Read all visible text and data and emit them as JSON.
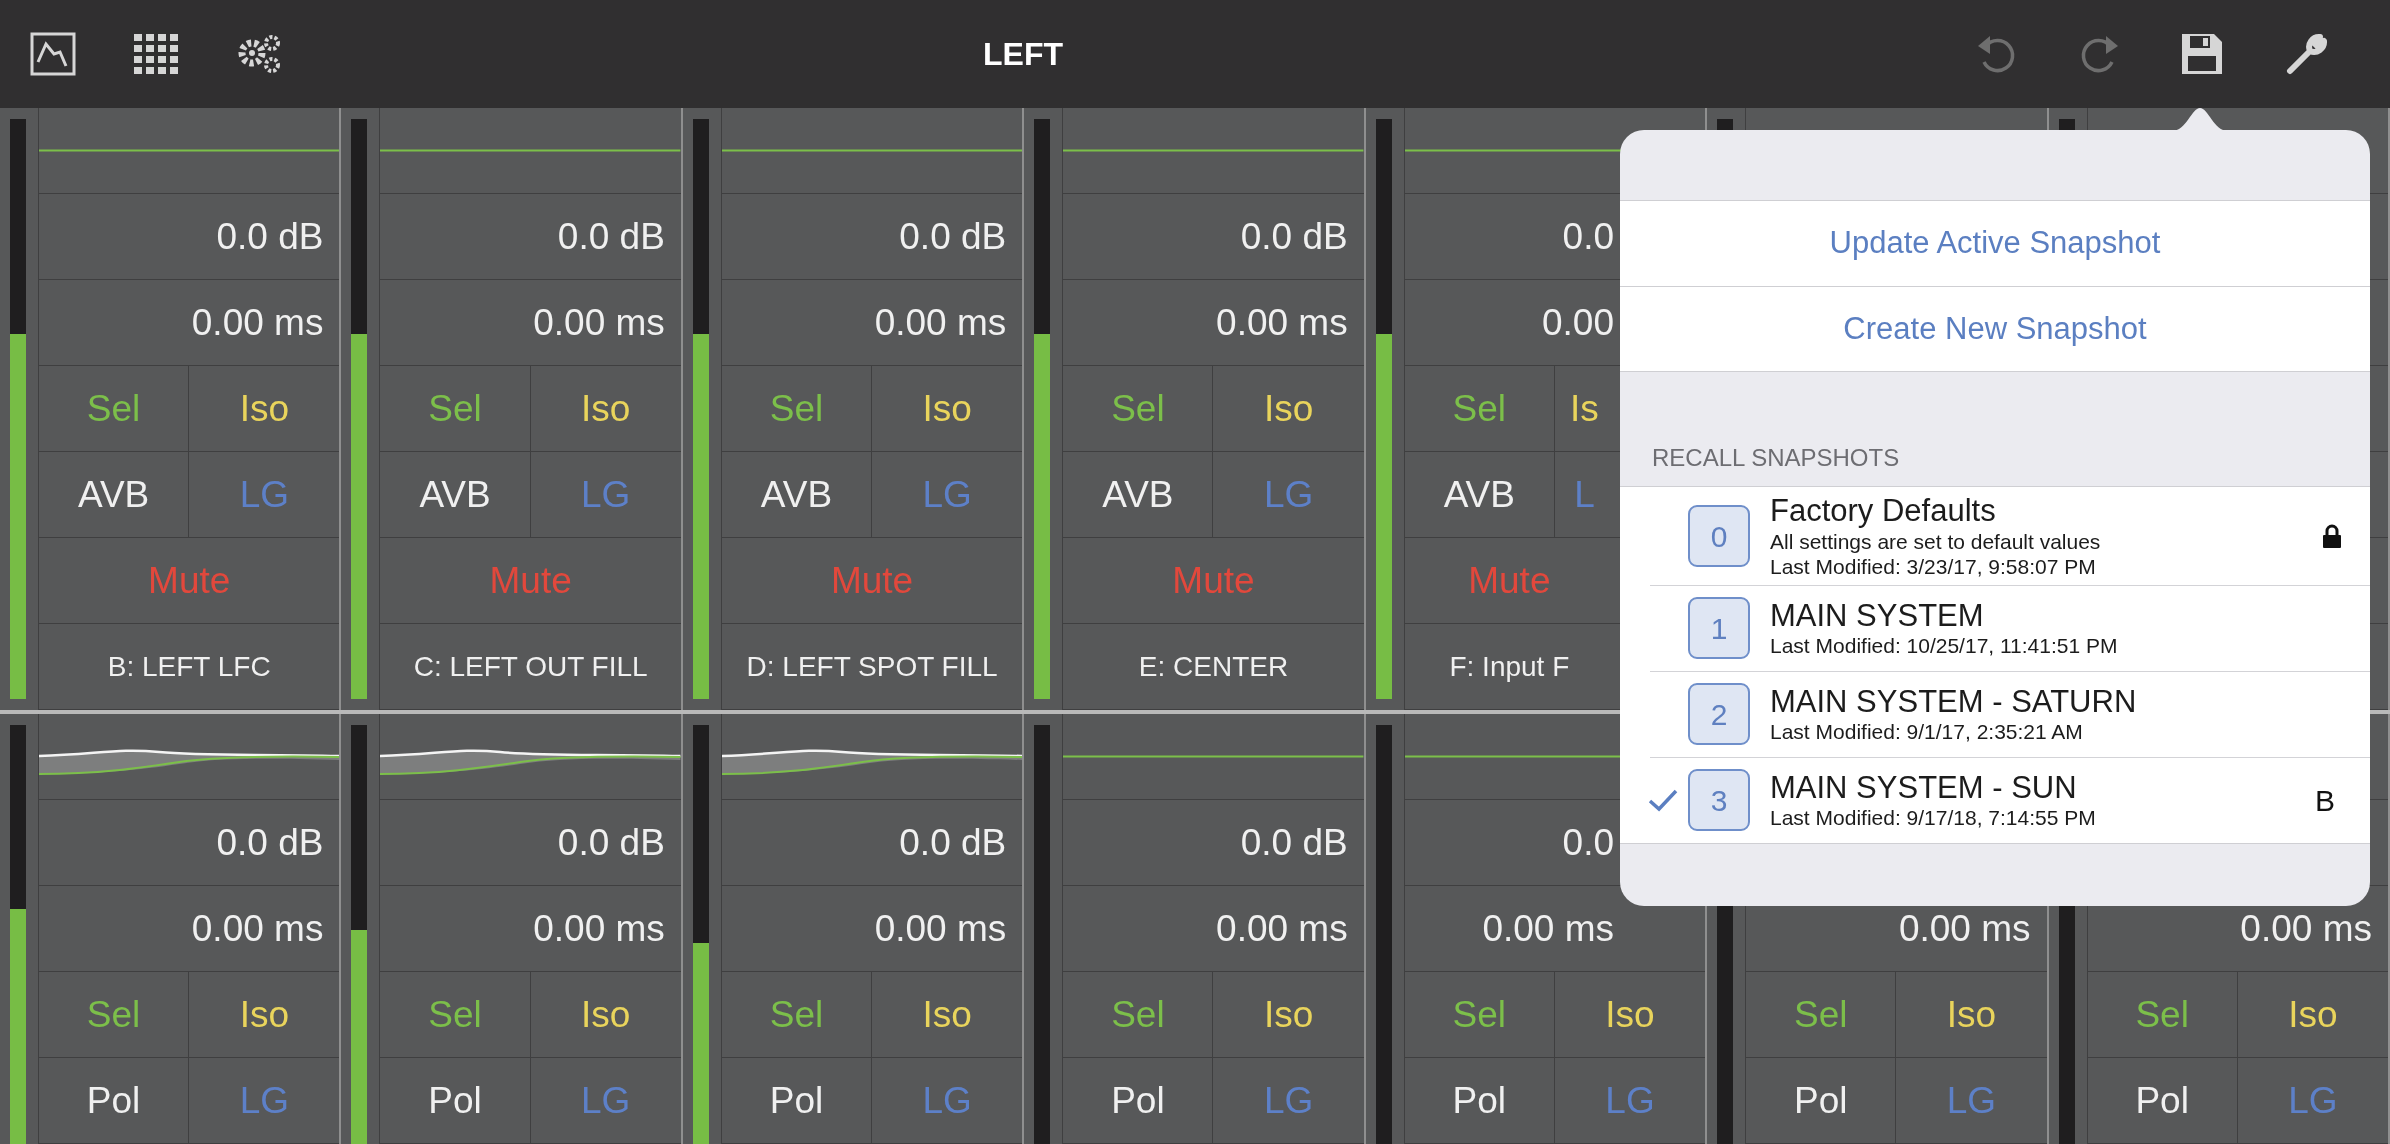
{
  "toolbar": {
    "title": "LEFT",
    "undo": {
      "disabled": true
    },
    "redo": {
      "disabled": true
    }
  },
  "strip_rows": [
    {
      "kind": "full",
      "strips": [
        {
          "meter": {
            "level": 0.63
          },
          "eq_shaped": false,
          "gain": "0.0 dB",
          "delay": "0.00 ms",
          "sel": "Sel",
          "iso": "Iso",
          "mode": "AVB",
          "lg": "LG",
          "mute": "Mute",
          "name": "B: LEFT LFC"
        },
        {
          "meter": {
            "level": 0.63
          },
          "eq_shaped": false,
          "gain": "0.0 dB",
          "delay": "0.00 ms",
          "sel": "Sel",
          "iso": "Iso",
          "mode": "AVB",
          "lg": "LG",
          "mute": "Mute",
          "name": "C: LEFT OUT FILL"
        },
        {
          "meter": {
            "level": 0.63
          },
          "eq_shaped": false,
          "gain": "0.0 dB",
          "delay": "0.00 ms",
          "sel": "Sel",
          "iso": "Iso",
          "mode": "AVB",
          "lg": "LG",
          "mute": "Mute",
          "name": "D: LEFT SPOT FILL"
        },
        {
          "meter": {
            "level": 0.63
          },
          "eq_shaped": false,
          "gain": "0.0 dB",
          "delay": "0.00 ms",
          "sel": "Sel",
          "iso": "Iso",
          "mode": "AVB",
          "lg": "LG",
          "mute": "Mute",
          "name": "E: CENTER"
        },
        {
          "meter": {
            "level": 0.63
          },
          "eq_shaped": false,
          "gain": "0.0",
          "delay": "0.00",
          "sel": "Sel",
          "iso": "Is",
          "mode": "AVB",
          "lg": "L",
          "mute": "Mute",
          "name": "F: Input F"
        }
      ]
    },
    {
      "kind": "compact",
      "strips": [
        {
          "meter": {
            "level": 0.56
          },
          "eq_shaped": true,
          "gain": "0.0 dB",
          "delay": "0.00 ms",
          "sel": "Sel",
          "iso": "Iso",
          "mode": "Pol",
          "lg": "LG"
        },
        {
          "meter": {
            "level": 0.51
          },
          "eq_shaped": true,
          "gain": "0.0 dB",
          "delay": "0.00 ms",
          "sel": "Sel",
          "iso": "Iso",
          "mode": "Pol",
          "lg": "LG"
        },
        {
          "meter": {
            "level": 0.48
          },
          "eq_shaped": true,
          "gain": "0.0 dB",
          "delay": "0.00 ms",
          "sel": "Sel",
          "iso": "Iso",
          "mode": "Pol",
          "lg": "LG"
        },
        {
          "eq_shaped": false,
          "gain": "0.0 dB",
          "delay": "0.00 ms",
          "sel": "Sel",
          "iso": "Iso",
          "mode": "Pol",
          "lg": "LG"
        },
        {
          "eq_shaped": false,
          "gain": "0.0",
          "delay": "0.00 ms",
          "sel": "Sel",
          "iso": "Iso",
          "mode": "Pol",
          "lg": "LG"
        },
        {
          "delay": "0.00 ms",
          "sel": "Sel",
          "iso": "Iso",
          "mode": "Pol",
          "lg": "LG"
        },
        {
          "delay": "0.00 ms",
          "sel": "Sel",
          "iso": "Iso",
          "mode": "Pol",
          "lg": "LG"
        }
      ]
    }
  ],
  "snapshot_popover": {
    "actions": [
      "Update Active Snapshot",
      "Create New Snapshot"
    ],
    "section_header": "RECALL SNAPSHOTS",
    "snapshots": [
      {
        "number": "0",
        "name": "Factory Defaults",
        "description": "All settings are set to default values",
        "modified": "Last Modified: 3/23/17, 9:58:07 PM",
        "locked": true,
        "selected": false
      },
      {
        "number": "1",
        "name": "MAIN SYSTEM",
        "modified": "Last Modified: 10/25/17, 11:41:51 PM",
        "locked": false,
        "selected": false
      },
      {
        "number": "2",
        "name": "MAIN SYSTEM - SATURN",
        "modified": "Last Modified: 9/1/17, 2:35:21 AM",
        "locked": false,
        "selected": false
      },
      {
        "number": "3",
        "name": "MAIN SYSTEM - SUN",
        "modified": "Last Modified: 9/17/18, 7:14:55 PM",
        "locked": false,
        "selected": true,
        "tag": "B"
      }
    ]
  }
}
